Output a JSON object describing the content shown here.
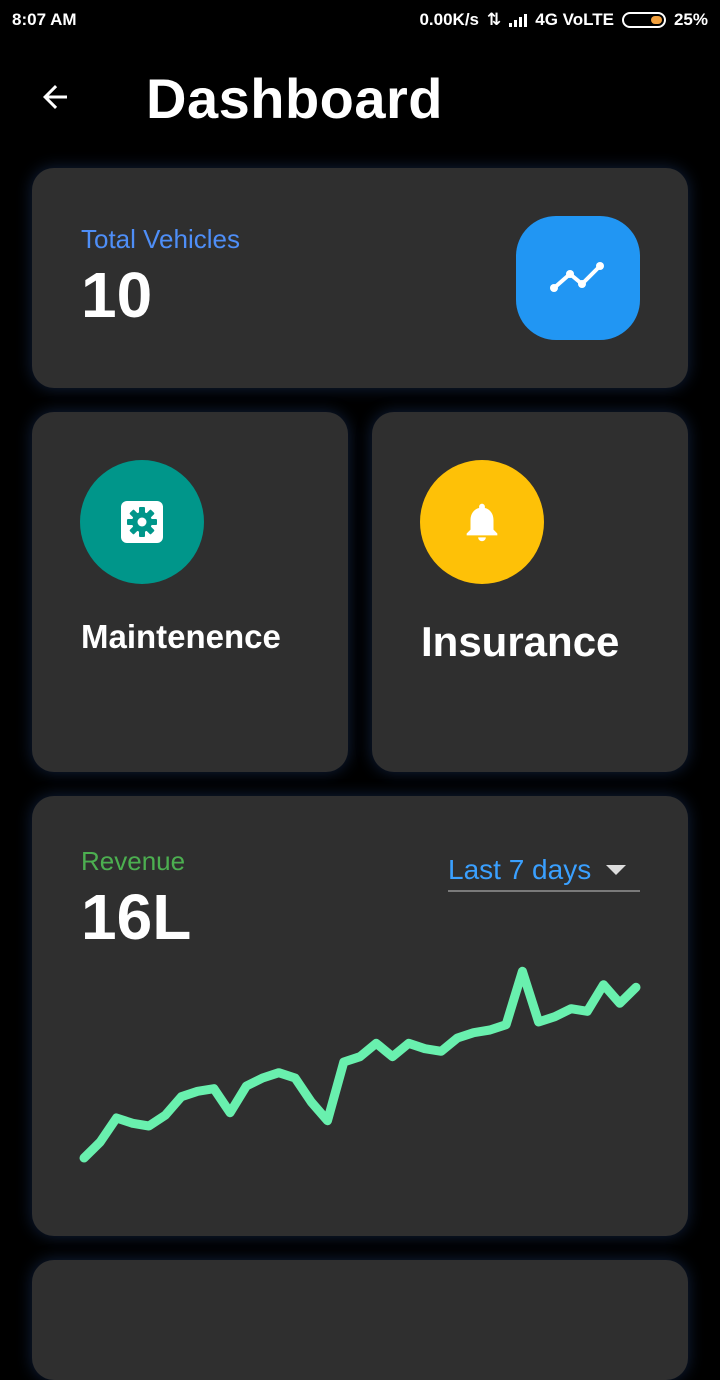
{
  "status": {
    "time": "8:07 AM",
    "net_speed": "0.00K/s",
    "network": "4G VoLTE",
    "battery": "25%"
  },
  "header": {
    "title": "Dashboard"
  },
  "vehicles": {
    "label": "Total Vehicles",
    "value": "10",
    "accent": "#4e8ef7",
    "icon": "trend-icon",
    "icon_bg": "#2196f3"
  },
  "maintenance": {
    "label": "Maintenence",
    "icon": "gear-icon",
    "icon_bg": "#00968a"
  },
  "insurance": {
    "label": "Insurance",
    "icon": "bell-icon",
    "icon_bg": "#fec107"
  },
  "revenue": {
    "label": "Revenue",
    "value": "16L",
    "accent": "#4caf50",
    "period": "Last 7 days"
  },
  "chart_data": {
    "type": "line",
    "x": [
      1,
      2,
      3,
      4,
      5,
      6,
      7,
      8,
      9,
      10,
      11,
      12,
      13,
      14,
      15,
      16,
      17,
      18,
      19,
      20,
      21,
      22,
      23,
      24,
      25,
      26,
      27,
      28,
      29,
      30,
      31,
      32,
      33,
      34,
      35
    ],
    "values": [
      0,
      6,
      15,
      13,
      12,
      16,
      23,
      25,
      26,
      17,
      27,
      30,
      32,
      30,
      21,
      14,
      36,
      38,
      43,
      38,
      43,
      41,
      40,
      45,
      47,
      48,
      50,
      70,
      51,
      53,
      56,
      55,
      65,
      58,
      64
    ],
    "ylim": [
      0,
      72
    ],
    "color": "#69f0ae",
    "grid": false
  }
}
